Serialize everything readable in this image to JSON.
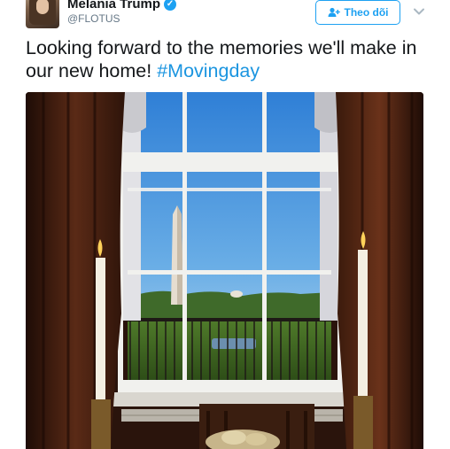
{
  "user": {
    "display_name": "Melania Trump",
    "handle": "@FLOTUS",
    "verified": true
  },
  "follow_button": {
    "label": "Theo dõi",
    "icon": "add-user-icon"
  },
  "menu": {
    "icon": "chevron-down-icon"
  },
  "tweet": {
    "text": "Looking forward to the memories we'll make in our new home!",
    "hashtag": "#Movingday"
  },
  "colors": {
    "accent": "#1da1f2",
    "hashtag": "#1b95e0",
    "text": "#14171a",
    "secondary_text": "#657786"
  }
}
